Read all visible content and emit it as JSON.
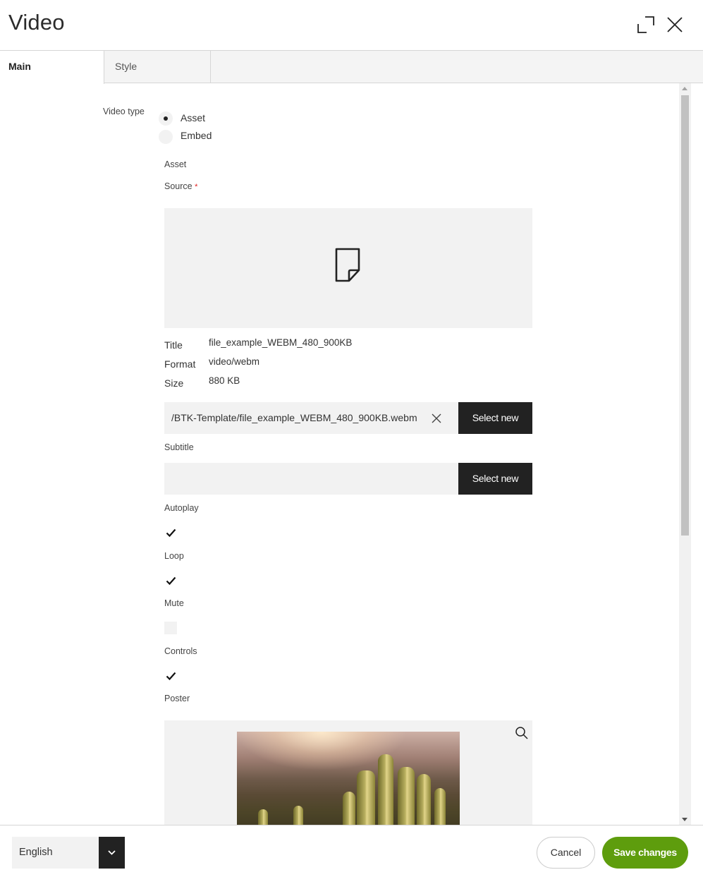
{
  "dialog": {
    "title": "Video"
  },
  "icons": {
    "expand": "expand-icon",
    "close": "close-icon",
    "document": "document-icon",
    "clear": "close-icon",
    "zoom": "search-icon",
    "dropdown": "chevron-down-icon",
    "check": "checkmark-icon"
  },
  "tabs": [
    {
      "label": "Main",
      "active": true
    },
    {
      "label": "Style",
      "active": false
    }
  ],
  "form": {
    "video_type_label": "Video type",
    "video_type_options": [
      {
        "label": "Asset",
        "selected": true
      },
      {
        "label": "Embed",
        "selected": false
      }
    ],
    "asset_section_label": "Asset",
    "source_label": "Source",
    "required_mark": "*",
    "file_meta": [
      {
        "key": "Title",
        "value": "file_example_WEBM_480_900KB"
      },
      {
        "key": "Format",
        "value": "video/webm"
      },
      {
        "key": "Size",
        "value": "880 KB"
      }
    ],
    "source_path": "/BTK-Template/file_example_WEBM_480_900KB.webm",
    "select_new_label": "Select new",
    "subtitle_label": "Subtitle",
    "subtitle_value": "",
    "checkboxes": [
      {
        "label": "Autoplay",
        "checked": true
      },
      {
        "label": "Loop",
        "checked": true
      },
      {
        "label": "Mute",
        "checked": false
      },
      {
        "label": "Controls",
        "checked": true
      }
    ],
    "poster_label": "Poster"
  },
  "footer": {
    "language": "English",
    "cancel_label": "Cancel",
    "save_label": "Save changes"
  },
  "colors": {
    "accent": "#5e9d0d",
    "dark_button": "#222222",
    "required": "#e02020"
  }
}
